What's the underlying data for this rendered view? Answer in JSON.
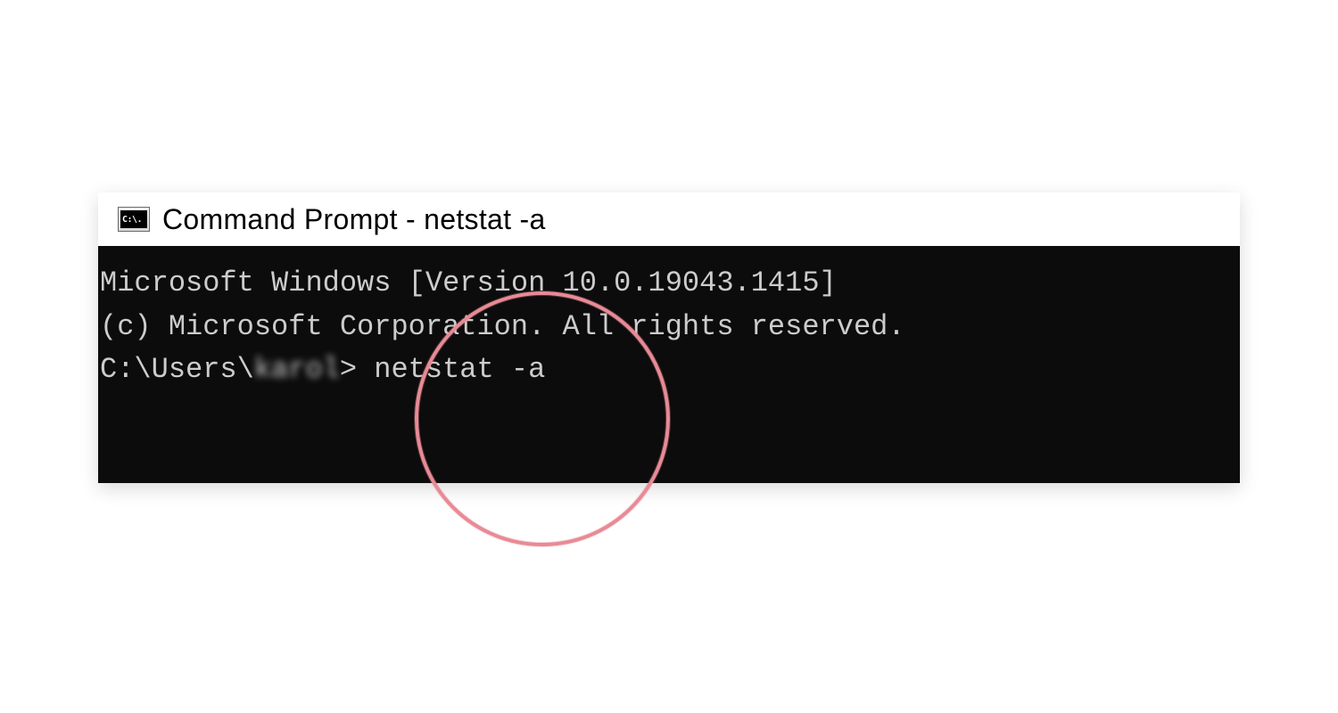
{
  "window": {
    "icon_text": "C:\\.",
    "title": "Command Prompt - netstat  -a"
  },
  "terminal": {
    "line1": "Microsoft Windows [Version 10.0.19043.1415]",
    "line2": "(c) Microsoft Corporation. All rights reserved.",
    "blank": "",
    "prompt_prefix": "C:\\Users\\",
    "prompt_user_blurred": "karol",
    "prompt_suffix": "> ",
    "command": "netstat -a"
  },
  "annotation": {
    "circle_color": "#e88a96"
  }
}
